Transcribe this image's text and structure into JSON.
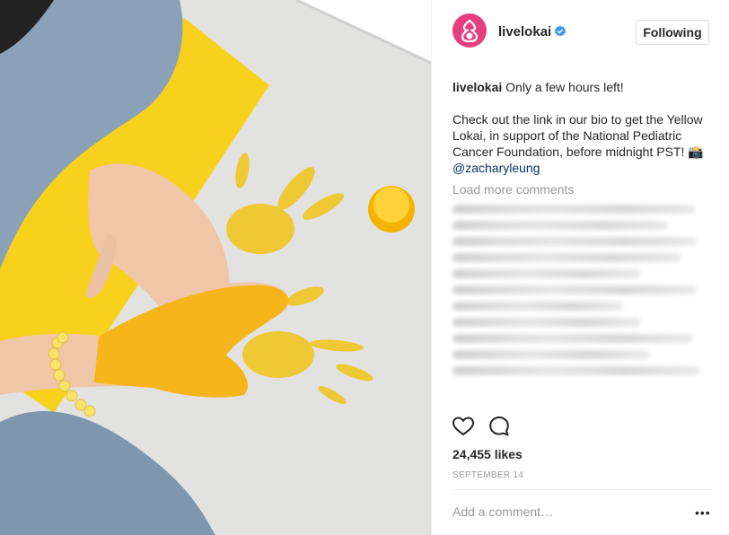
{
  "post": {
    "username": "livelokai",
    "follow_label": "Following",
    "caption_user": "livelokai",
    "caption_line1": "Only a few hours left!",
    "caption_body": "Check out the link in our bio to get the Yellow Lokai, in support of the National Pediatric Cancer Foundation, before midnight PST! 📸",
    "caption_mention": "@zacharyleung",
    "load_more": "Load more comments",
    "likes": "24,455 likes",
    "date": "SEPTEMBER 14",
    "add_comment_placeholder": "Add a comment…",
    "more_label": "•••"
  },
  "icons": {
    "avatar": "lokai-logo-icon",
    "verified": "verified-badge-icon",
    "like": "heart-icon",
    "comment": "comment-bubble-icon"
  },
  "colors": {
    "brand_pink": "#e5407e",
    "verified_blue": "#3897f0",
    "mention_blue": "#003569",
    "muted_gray": "#999999",
    "paint_yellow": "#f6c21c"
  }
}
